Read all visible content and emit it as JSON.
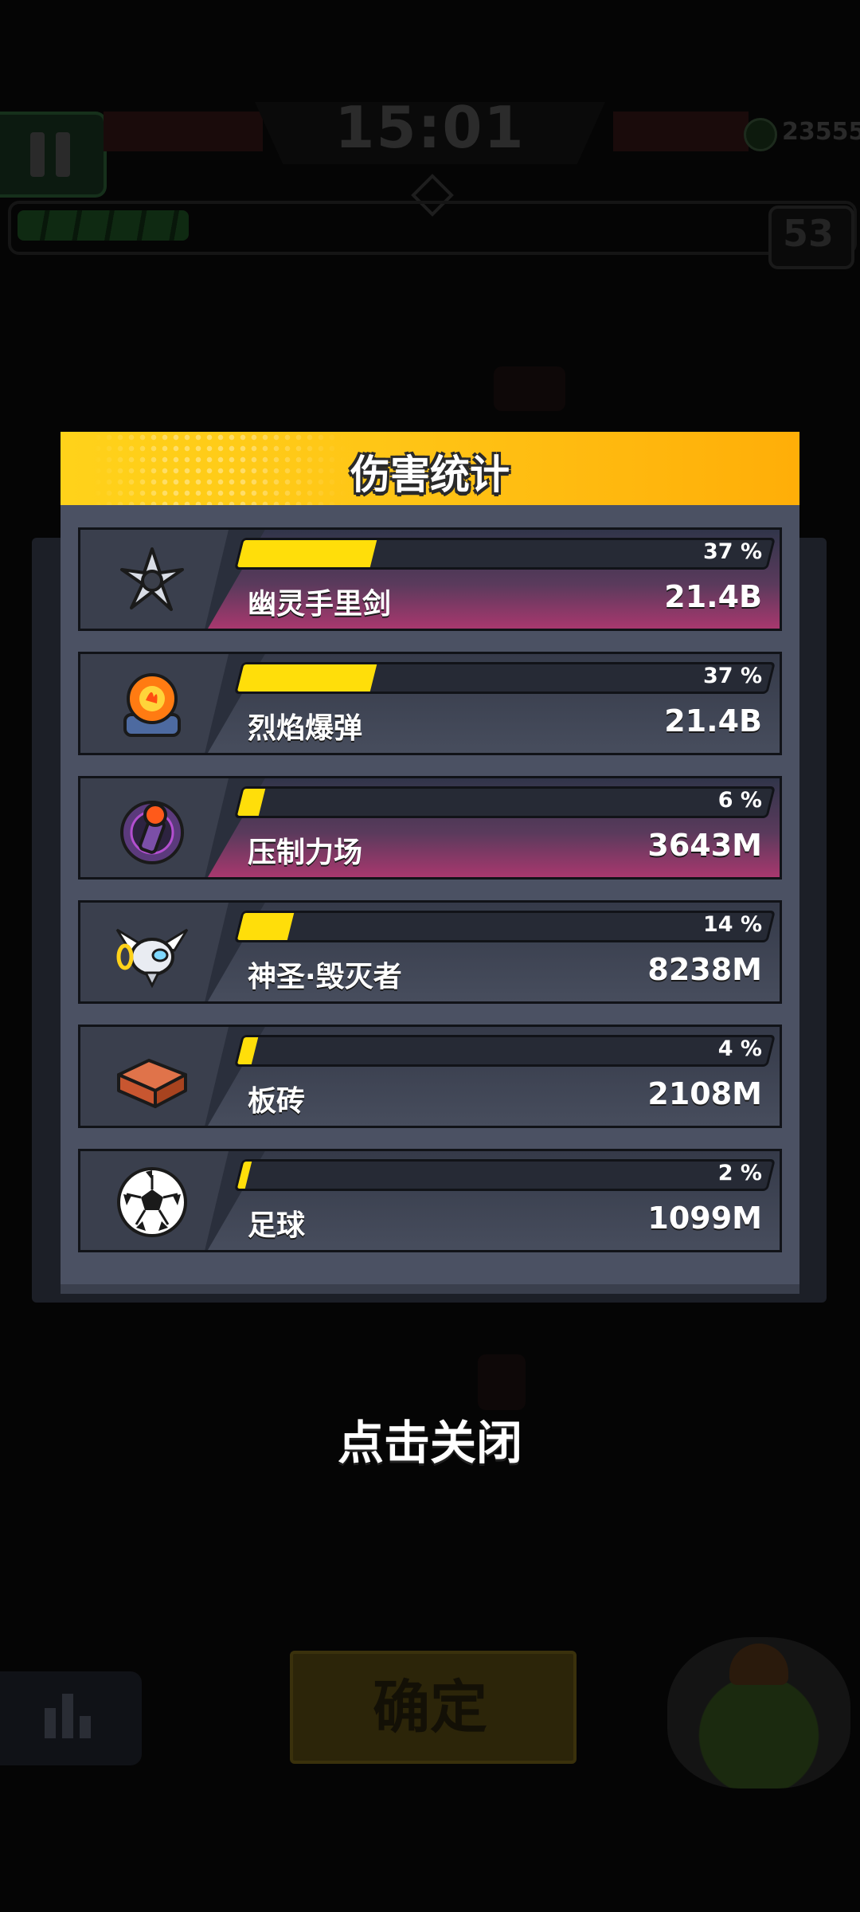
{
  "hud": {
    "timer": "15:01",
    "coins": "23555",
    "level": "53"
  },
  "modal": {
    "title": "伤害统计",
    "rows": [
      {
        "name": "幽灵手里剑",
        "percent_label": "37 %",
        "percent": 37,
        "damage": "21.4B",
        "icon": "ghost-shuriken-icon",
        "highlight": true
      },
      {
        "name": "烈焰爆弹",
        "percent_label": "37 %",
        "percent": 37,
        "damage": "21.4B",
        "icon": "flame-bomb-icon",
        "highlight": false
      },
      {
        "name": "压制力场",
        "percent_label": "6 %",
        "percent": 6,
        "damage": "3643M",
        "icon": "suppression-field-icon",
        "highlight": true
      },
      {
        "name": "神圣·毁灭者",
        "percent_label": "14 %",
        "percent": 14,
        "damage": "8238M",
        "icon": "holy-destroyer-drone-icon",
        "highlight": false
      },
      {
        "name": "板砖",
        "percent_label": "4 %",
        "percent": 4,
        "damage": "2108M",
        "icon": "brick-icon",
        "highlight": false
      },
      {
        "name": "足球",
        "percent_label": "2 %",
        "percent": 2,
        "damage": "1099M",
        "icon": "soccer-ball-icon",
        "highlight": false
      }
    ]
  },
  "close_hint": "点击关闭",
  "confirm_label": "确定",
  "colors": {
    "header_yellow": "#ffc516",
    "bar_fill": "#ffde0a",
    "panel": "#4b5163",
    "highlight_row": "#a8386e"
  }
}
